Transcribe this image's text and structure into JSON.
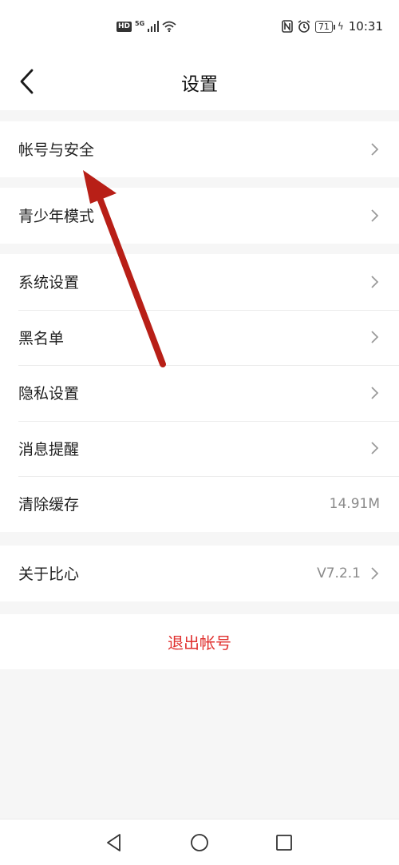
{
  "status_bar": {
    "hd": "HD",
    "network": "5G",
    "battery": "71",
    "time": "10:31"
  },
  "header": {
    "title": "设置"
  },
  "groups": [
    {
      "items": [
        {
          "label": "帐号与安全",
          "chevron": true
        }
      ]
    },
    {
      "items": [
        {
          "label": "青少年模式",
          "chevron": true
        }
      ]
    },
    {
      "items": [
        {
          "label": "系统设置",
          "chevron": true
        },
        {
          "label": "黑名单",
          "chevron": true
        },
        {
          "label": "隐私设置",
          "chevron": true
        },
        {
          "label": "消息提醒",
          "chevron": true
        },
        {
          "label": "清除缓存",
          "value": "14.91M",
          "chevron": false
        }
      ]
    },
    {
      "items": [
        {
          "label": "关于比心",
          "value": "V7.2.1",
          "chevron": true
        }
      ]
    }
  ],
  "logout": {
    "label": "退出帐号"
  },
  "colors": {
    "accent_red": "#e0312f",
    "annotation_arrow": "#b81f17"
  },
  "icons": [
    "back-arrow-icon",
    "chevron-right-icon",
    "nav-back-icon",
    "nav-home-icon",
    "nav-recents-icon",
    "wifi-icon",
    "signal-icon",
    "nfc-icon",
    "alarm-icon",
    "battery-icon"
  ]
}
